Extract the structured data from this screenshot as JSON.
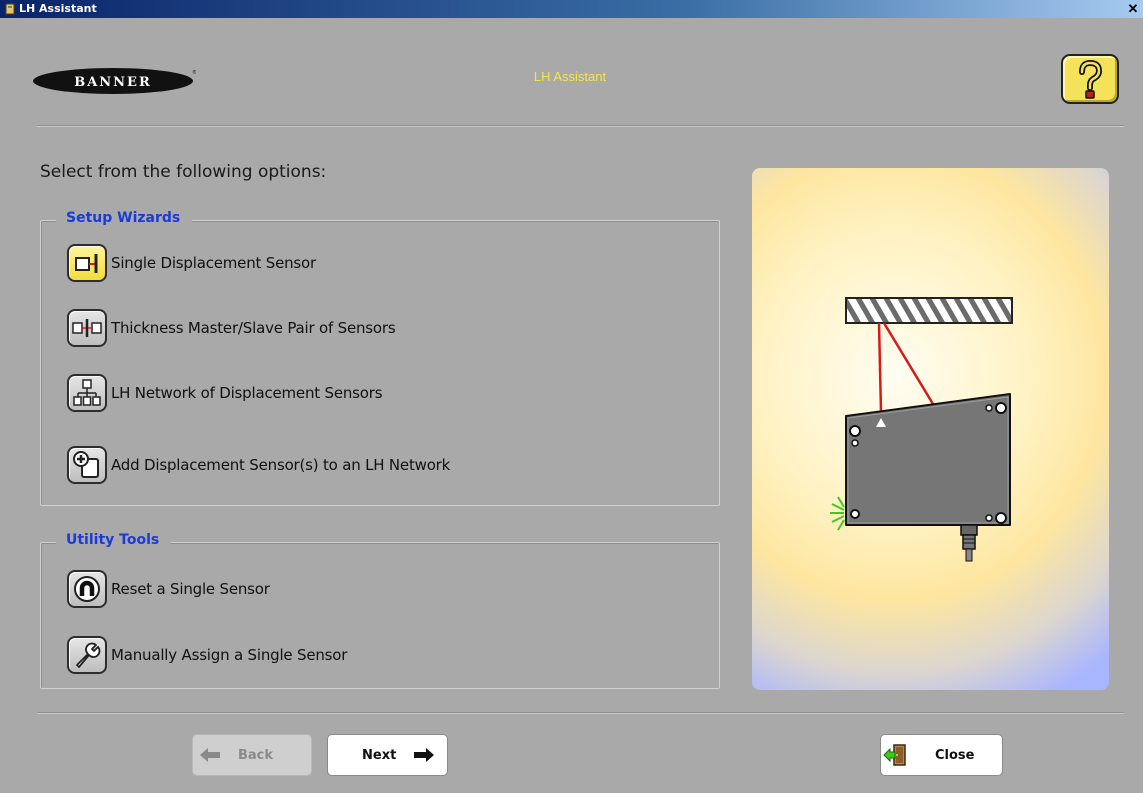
{
  "window": {
    "title": "LH Assistant",
    "close_glyph": "✕"
  },
  "header": {
    "logo_text": "BANNER",
    "title": "LH Assistant",
    "help_icon": "question-mark-icon",
    "colors": {
      "title": "#f2e64b",
      "help_button": "#f3e25a"
    }
  },
  "intro": "Select from the following options:",
  "setup_wizards": {
    "legend": "Setup Wizards",
    "items": [
      {
        "label": "Single Displacement Sensor",
        "icon": "single-sensor-icon",
        "selected": true
      },
      {
        "label": "Thickness Master/Slave Pair of Sensors",
        "icon": "sensor-pair-icon",
        "selected": false
      },
      {
        "label": "LH Network of Displacement Sensors",
        "icon": "network-icon",
        "selected": false
      },
      {
        "label": "Add Displacement Sensor(s) to an LH Network",
        "icon": "add-sensor-icon",
        "selected": false
      }
    ]
  },
  "utility_tools": {
    "legend": "Utility Tools",
    "items": [
      {
        "label": "Reset a Single Sensor",
        "icon": "reset-icon"
      },
      {
        "label": "Manually Assign a Single Sensor",
        "icon": "wrench-icon"
      }
    ]
  },
  "buttons": {
    "back": "Back",
    "next": "Next",
    "close": "Close",
    "back_enabled": false
  },
  "colors": {
    "legend": "#1a3bd9",
    "laser": "#d61a1a",
    "indicator": "#3ccc1e"
  }
}
